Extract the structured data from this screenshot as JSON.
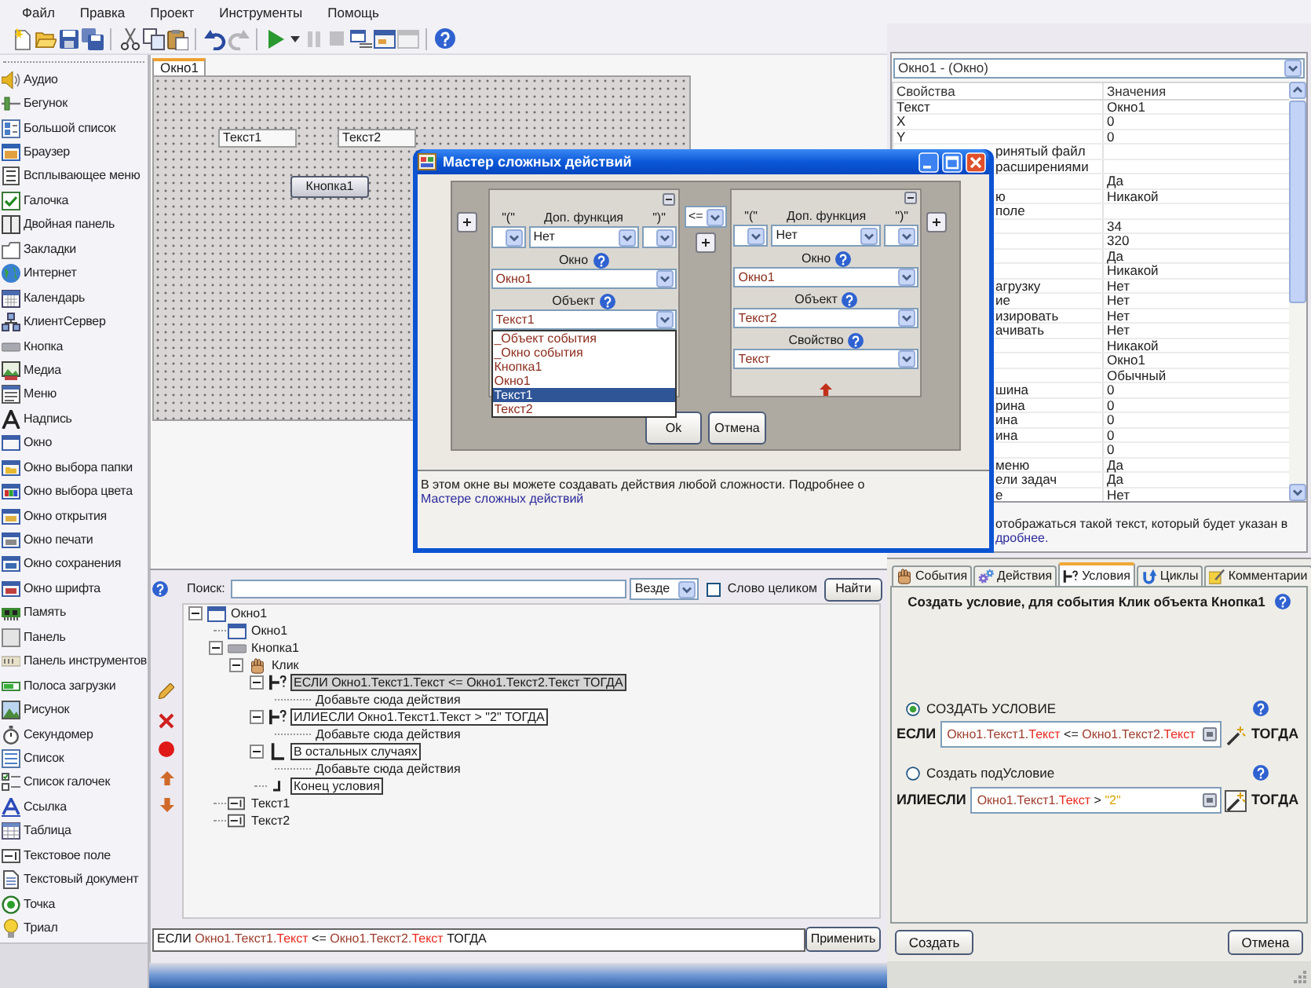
{
  "menu": [
    "Файл",
    "Правка",
    "Проект",
    "Инструменты",
    "Помощь"
  ],
  "toolbar": {
    "groups": [
      [
        {
          "kind": "new",
          "disabled": false
        },
        {
          "kind": "open",
          "disabled": false
        },
        {
          "kind": "save",
          "disabled": false
        },
        {
          "kind": "save_all",
          "disabled": false
        }
      ],
      [
        {
          "kind": "cut",
          "disabled": false
        },
        {
          "kind": "copy",
          "disabled": false
        },
        {
          "kind": "paste",
          "disabled": false
        }
      ],
      [
        {
          "kind": "undo",
          "disabled": false
        },
        {
          "kind": "redo",
          "disabled": true
        }
      ],
      [
        {
          "kind": "run",
          "disabled": false
        },
        {
          "kind": "run_menu",
          "disabled": false
        },
        {
          "kind": "pause",
          "disabled": true
        },
        {
          "kind": "stop",
          "disabled": true
        },
        {
          "kind": "step",
          "disabled": false
        },
        {
          "kind": "frame",
          "disabled": false
        },
        {
          "kind": "frame_alt",
          "disabled": true
        }
      ],
      [
        {
          "kind": "help",
          "disabled": false
        }
      ]
    ]
  },
  "toolbox": {
    "items": [
      {
        "kind": "audio",
        "label": "Аудио"
      },
      {
        "kind": "slider",
        "label": "Бегунок"
      },
      {
        "kind": "big_list",
        "label": "Большой список"
      },
      {
        "kind": "browser",
        "label": "Браузер"
      },
      {
        "kind": "popup_menu",
        "label": "Всплывающее меню"
      },
      {
        "kind": "checkbox",
        "label": "Галочка"
      },
      {
        "kind": "split_panel",
        "label": "Двойная панель"
      },
      {
        "kind": "tabs",
        "label": "Закладки"
      },
      {
        "kind": "internet",
        "label": "Интернет"
      },
      {
        "kind": "calendar",
        "label": "Календарь"
      },
      {
        "kind": "client_server",
        "label": "КлиентСервер"
      },
      {
        "kind": "button",
        "label": "Кнопка"
      },
      {
        "kind": "media",
        "label": "Медиа"
      },
      {
        "kind": "menu",
        "label": "Меню"
      },
      {
        "kind": "label",
        "label": "Надпись"
      },
      {
        "kind": "window",
        "label": "Окно"
      },
      {
        "kind": "folder_dialog",
        "label": "Окно выбора папки"
      },
      {
        "kind": "color_dialog",
        "label": "Окно выбора цвета"
      },
      {
        "kind": "open_dialog",
        "label": "Окно открытия"
      },
      {
        "kind": "print_dialog",
        "label": "Окно печати"
      },
      {
        "kind": "save_dialog",
        "label": "Окно сохранения"
      },
      {
        "kind": "font_dialog",
        "label": "Окно шрифта"
      },
      {
        "kind": "memory",
        "label": "Память"
      },
      {
        "kind": "panel",
        "label": "Панель"
      },
      {
        "kind": "toolbar",
        "label": "Панель инструментов"
      },
      {
        "kind": "progress",
        "label": "Полоса загрузки"
      },
      {
        "kind": "picture",
        "label": "Рисунок"
      },
      {
        "kind": "stopwatch",
        "label": "Секундомер"
      },
      {
        "kind": "list",
        "label": "Список"
      },
      {
        "kind": "check_list",
        "label": "Список галочек"
      },
      {
        "kind": "link",
        "label": "Ссылка"
      },
      {
        "kind": "table",
        "label": "Таблица"
      },
      {
        "kind": "text_field",
        "label": "Текстовое поле"
      },
      {
        "kind": "text_document",
        "label": "Текстовый документ"
      },
      {
        "kind": "radio",
        "label": "Точка"
      },
      {
        "kind": "trial",
        "label": "Триал"
      }
    ]
  },
  "designer": {
    "tabs": [
      {
        "label": "Окно1",
        "selected": true
      }
    ],
    "controls": [
      {
        "kind": "textbox",
        "text": "Текст1"
      },
      {
        "kind": "textbox",
        "text": "Текст2"
      },
      {
        "kind": "button",
        "text": "Кнопка1"
      }
    ]
  },
  "properties": {
    "object": "Окно1 - (Окно)",
    "columns": [
      "Свойства",
      "Значения"
    ],
    "rows": [
      {
        "name": "Текст",
        "value": "Окно1"
      },
      {
        "name": "X",
        "value": "0"
      },
      {
        "name": "Y",
        "value": "0"
      },
      {
        "name": "ринятый файл"
      },
      {
        "name": "расширениями"
      },
      {
        "value": "Да"
      },
      {
        "name": "ю",
        "value": "Никакой"
      },
      {
        "name": "поле"
      },
      {
        "value": "34"
      },
      {
        "value": "320"
      },
      {
        "value": "Да"
      },
      {
        "value": "Никакой"
      },
      {
        "name": "агрузку",
        "value": "Нет"
      },
      {
        "name": "ие",
        "value": "Нет"
      },
      {
        "name": "изировать",
        "value": "Нет"
      },
      {
        "name": "ачивать",
        "value": "Нет"
      },
      {
        "value": "Никакой"
      },
      {
        "value": "Окно1"
      },
      {
        "value": "Обычный"
      },
      {
        "name": "шина",
        "value": "0"
      },
      {
        "name": "рина",
        "value": "0"
      },
      {
        "name": "ина",
        "value": "0"
      },
      {
        "name": "ина",
        "value": "0"
      },
      {
        "value": "0"
      },
      {
        "name": "меню",
        "value": "Да"
      },
      {
        "name": "ели задач",
        "value": "Да"
      },
      {
        "name": "е",
        "value": "Нет"
      }
    ],
    "description": {
      "text": "отображаться такой текст, который будет указан в",
      "link": "дробнее."
    }
  },
  "dialog": {
    "title": "Мастер сложных действий",
    "operands": [
      {
        "paren_open_label": "\"(\"",
        "function_label": "Доп. функция",
        "paren_close_label": "\")\"",
        "function": "Нет",
        "window_label": "Окно",
        "window": "Окно1",
        "object_label": "Объект",
        "object": "Текст1",
        "object_list": [
          {
            "label": "_Объект события",
            "selected": false
          },
          {
            "label": "_Окно события",
            "selected": false
          },
          {
            "label": "Кнопка1",
            "selected": false
          },
          {
            "label": "Окно1",
            "selected": false
          },
          {
            "label": "Текст1",
            "selected": true
          },
          {
            "label": "Текст2",
            "selected": false
          }
        ]
      },
      {
        "paren_open_label": "\"(\"",
        "function_label": "Доп. функция",
        "paren_close_label": "\")\"",
        "function": "Нет",
        "window_label": "Окно",
        "window": "Окно1",
        "object_label": "Объект",
        "object": "Текст2",
        "property_label": "Свойство",
        "property": "Текст"
      }
    ],
    "operator": "<=",
    "buttons": [
      "Ok",
      "Отмена"
    ],
    "info": {
      "text": "В этом окне вы можете создавать действия любой сложности. Подробнее о",
      "link": "Мастере сложных действий"
    }
  },
  "search": {
    "label": "Поиск:",
    "scope": "Везде",
    "whole_word": {
      "label": "Слово целиком",
      "checked": false
    },
    "button": "Найти"
  },
  "tree": [
    {
      "kind": "window",
      "label": "Окно1",
      "expanded": true,
      "selected": false,
      "children": [
        {
          "kind": "window",
          "label": "Окно1",
          "selected": false
        },
        {
          "kind": "button",
          "label": "Кнопка1",
          "expanded": true,
          "selected": false,
          "children": [
            {
              "kind": "event",
              "label": "Клик",
              "expanded": true,
              "selected": false,
              "children": [
                {
                  "kind": "if",
                  "label": "ЕСЛИ Окно1.Текст1.Текст <= Окно1.Текст2.Текст ТОГДА",
                  "expanded": true,
                  "selected": true,
                  "children": [
                    {
                      "kind": "placeholder",
                      "label": "Добавьте сюда действия",
                      "selected": false
                    }
                  ]
                },
                {
                  "kind": "elseif",
                  "label": "ИЛИЕСЛИ Окно1.Текст1.Текст > \"2\" ТОГДА",
                  "expanded": true,
                  "selected": false,
                  "children": [
                    {
                      "kind": "placeholder",
                      "label": "Добавьте сюда действия",
                      "selected": false
                    }
                  ]
                },
                {
                  "kind": "else",
                  "label": "В остальных случаях",
                  "expanded": true,
                  "selected": false,
                  "children": [
                    {
                      "kind": "placeholder",
                      "label": "Добавьте сюда действия",
                      "selected": false
                    }
                  ]
                },
                {
                  "kind": "endif",
                  "label": "Конец условия",
                  "selected": false
                }
              ]
            }
          ]
        },
        {
          "kind": "textbox",
          "label": "Текст1",
          "selected": false
        },
        {
          "kind": "textbox",
          "label": "Текст2",
          "selected": false
        }
      ]
    }
  ],
  "editor": {
    "expression": [
      {
        "text": "ЕСЛИ",
        "kind": "keyword"
      },
      {
        "text": "Окно1.Текст1.",
        "kind": "object"
      },
      {
        "text": "Текст",
        "kind": "property"
      },
      {
        "text": "<=",
        "kind": "operator"
      },
      {
        "text": "Окно1.Текст2.",
        "kind": "object"
      },
      {
        "text": "Текст",
        "kind": "property"
      },
      {
        "text": "ТОГДА",
        "kind": "keyword"
      }
    ],
    "button": "Применить"
  },
  "conditions": {
    "tabs": [
      {
        "label": "События",
        "kind": "events",
        "selected": false
      },
      {
        "label": "Действия",
        "kind": "actions",
        "selected": false
      },
      {
        "label": "Условия",
        "kind": "conditions",
        "selected": true
      },
      {
        "label": "Циклы",
        "kind": "loops",
        "selected": false
      },
      {
        "label": "Комментарии",
        "kind": "comments",
        "selected": false
      }
    ],
    "heading": "Создать условие, для события Клик объекта Кнопка1",
    "options": [
      {
        "label": "СОЗДАТЬ УСЛОВИЕ",
        "selected": true,
        "keyword": "ЕСЛИ",
        "expression": [
          {
            "text": "Окно1.Текст1.",
            "kind": "object"
          },
          {
            "text": "Текст",
            "kind": "property"
          },
          {
            "text": "<=",
            "kind": "operator"
          },
          {
            "text": "Окно1.Текст2.",
            "kind": "object"
          },
          {
            "text": "Текст",
            "kind": "property"
          }
        ],
        "then": "ТОГДА",
        "wand_pressed": false
      },
      {
        "label": "Создать подУсловие",
        "selected": false,
        "keyword": "ИЛИЕСЛИ",
        "expression": [
          {
            "text": "Окно1.Текст1.",
            "kind": "object"
          },
          {
            "text": "Текст",
            "kind": "property"
          },
          {
            "text": ">",
            "kind": "operator"
          },
          {
            "text": "\"2\"",
            "kind": "literal"
          }
        ],
        "then": "ТОГДА",
        "wand_pressed": true
      }
    ],
    "buttons": [
      "Создать",
      "Отмена"
    ]
  }
}
